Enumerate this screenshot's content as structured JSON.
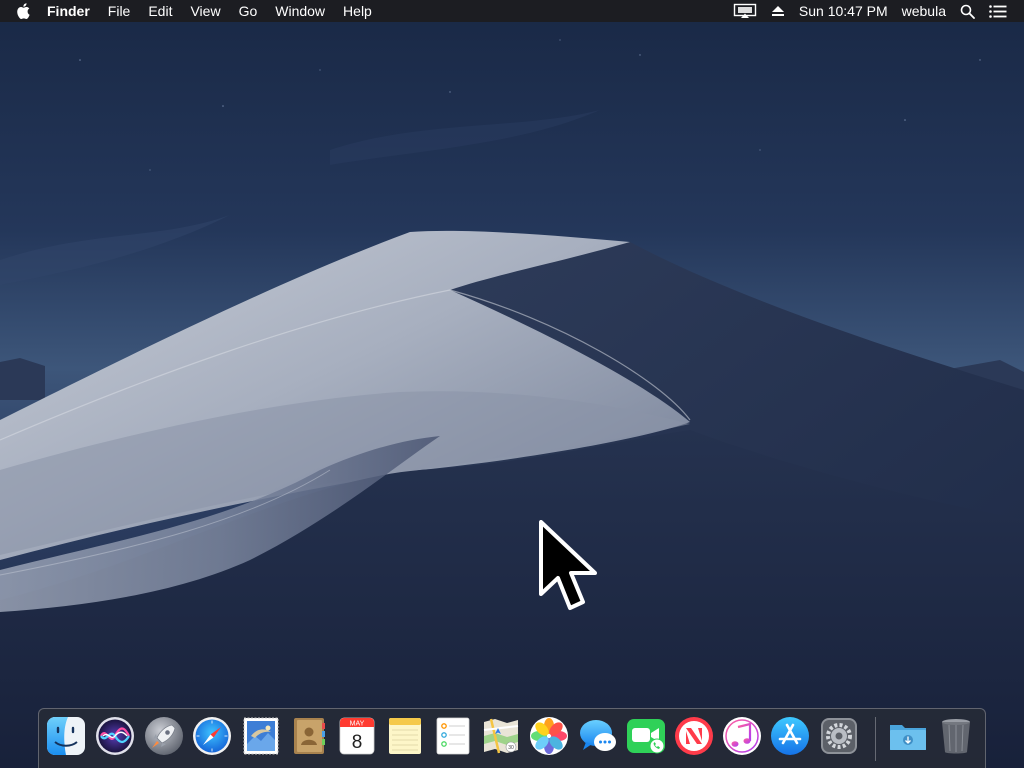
{
  "menubar": {
    "app_name": "Finder",
    "menus": [
      "File",
      "Edit",
      "View",
      "Go",
      "Window",
      "Help"
    ],
    "clock": "Sun 10:47 PM",
    "user": "webula"
  },
  "calendar_icon": {
    "month": "MAY",
    "day": "8"
  },
  "dock": {
    "apps": [
      "Finder",
      "Siri",
      "Launchpad",
      "Safari",
      "Mail",
      "Contacts",
      "Calendar",
      "Notes",
      "Reminders",
      "Maps",
      "Photos",
      "Messages",
      "FaceTime",
      "News",
      "iTunes",
      "App Store",
      "System Preferences"
    ],
    "running": [
      "Finder"
    ],
    "folders": [
      "Downloads"
    ],
    "trash": "Trash"
  },
  "colors": {
    "menubar_bg": "#1c1c20",
    "sky_top": "#1b2a4a",
    "sky_horizon": "#3d567a",
    "dune_light": "#b7bdc9",
    "dune_dark": "#26334f"
  }
}
